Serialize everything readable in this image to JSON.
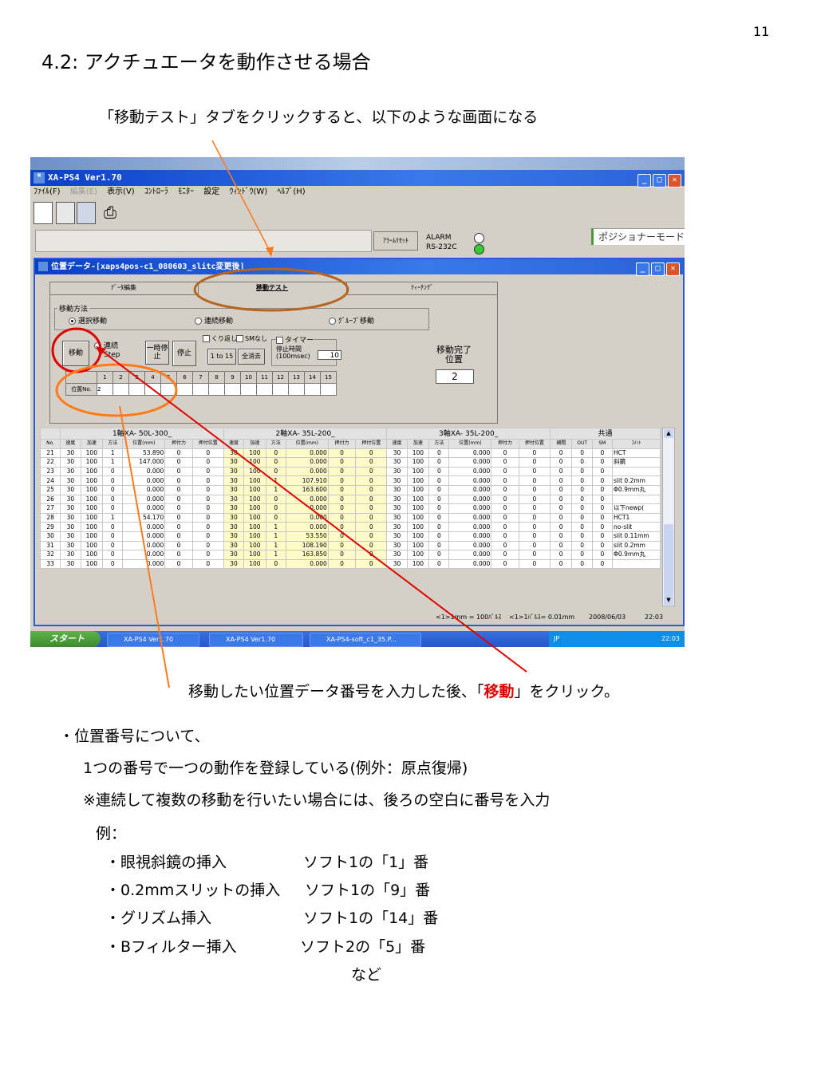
{
  "page_number": "11",
  "title": "4.2: アクチュエータを動作させる場合",
  "intro": "「移動テスト」タブをクリックすると、以下のような画面になる",
  "app": {
    "title": "XA-PS4 Ver1.70",
    "menu": [
      "ﾌｧｲﾙ(F)",
      "編集(E)",
      "表示(V)",
      "ｺﾝﾄﾛｰﾗ",
      "ﾓﾆﾀｰ",
      "設定",
      "ｳｨﾝﾄﾞｳ(W)",
      "ﾍﾙﾌﾟ(H)"
    ],
    "alarm_reset": "ｱﾗｰﾑﾘｾｯﾄ",
    "alarm_label": "ALARM",
    "rs232c_label": "RS-232C",
    "mode": "ポジショナーモード",
    "status_colors": {
      "alarm": "#ffffff",
      "rs232c": "#33cc33"
    }
  },
  "data_window": {
    "title": "位置データ-[xaps4pos-c1_080603_slitc変更後]",
    "tabs": [
      "ﾃﾞｰﾀ編集",
      "移動テスト",
      "ﾃｨｰﾁﾝｸﾞ"
    ],
    "move_method_label": "移動方法",
    "radios": [
      "選択移動",
      "連続移動",
      "ｸﾞﾙｰﾌﾟ移動"
    ],
    "move_button": "移動",
    "continuous": "連続",
    "step": "Step",
    "pause": "一時停止",
    "stop": "停止",
    "repeat": "くり返し",
    "no_sm": "SMなし",
    "timer": "タイマー",
    "one_to_15": "1 to 15",
    "clear_all": "全消去",
    "stop_time_label": "停止時間(100msec)",
    "stop_time_value": "10",
    "move_done_label": "移動完了位置",
    "move_done_value": "2",
    "pos_no_label": "位置No.",
    "pos_cols": [
      "1",
      "2",
      "3",
      "4",
      "5",
      "6",
      "7",
      "8",
      "9",
      "10",
      "11",
      "12",
      "13",
      "14",
      "15"
    ],
    "pos_values": [
      "2",
      "",
      "",
      "",
      "",
      "",
      "",
      "",
      "",
      "",
      "",
      "",
      "",
      "",
      ""
    ]
  },
  "grid": {
    "axis_headers": [
      "1軸XA- 50L-300_",
      "2軸XA- 35L-200_",
      "3軸XA- 35L-200_",
      "共通"
    ],
    "col_headers": [
      "No.",
      "速度",
      "加速",
      "方法",
      "位置(mm)",
      "押付力",
      "押付位置",
      "速度",
      "加速",
      "方法",
      "位置(mm)",
      "押付力",
      "押付位置",
      "速度",
      "加速",
      "方法",
      "位置(mm)",
      "押付力",
      "押付位置",
      "補間",
      "OUT",
      "SM",
      "ｺﾒﾝﾄ"
    ],
    "rows": [
      [
        "21",
        "30",
        "100",
        "1",
        "53.890",
        "0",
        "0",
        "30",
        "100",
        "0",
        "0.000",
        "0",
        "0",
        "30",
        "100",
        "0",
        "0.000",
        "0",
        "0",
        "0",
        "0",
        "0",
        "HCT"
      ],
      [
        "22",
        "30",
        "100",
        "1",
        "147.000",
        "0",
        "0",
        "30",
        "100",
        "0",
        "0.000",
        "0",
        "0",
        "30",
        "100",
        "0",
        "0.000",
        "0",
        "0",
        "0",
        "0",
        "0",
        "斜鏡"
      ],
      [
        "23",
        "30",
        "100",
        "0",
        "0.000",
        "0",
        "0",
        "30",
        "100",
        "0",
        "0.000",
        "0",
        "0",
        "30",
        "100",
        "0",
        "0.000",
        "0",
        "0",
        "0",
        "0",
        "0",
        ""
      ],
      [
        "24",
        "30",
        "100",
        "0",
        "0.000",
        "0",
        "0",
        "30",
        "100",
        "1",
        "107.910",
        "0",
        "0",
        "30",
        "100",
        "0",
        "0.000",
        "0",
        "0",
        "0",
        "0",
        "0",
        "slit 0.2mm"
      ],
      [
        "25",
        "30",
        "100",
        "0",
        "0.000",
        "0",
        "0",
        "30",
        "100",
        "1",
        "163.600",
        "0",
        "0",
        "30",
        "100",
        "0",
        "0.000",
        "0",
        "0",
        "0",
        "0",
        "0",
        "Φ0.9mm丸"
      ],
      [
        "26",
        "30",
        "100",
        "0",
        "0.000",
        "0",
        "0",
        "30",
        "100",
        "0",
        "0.000",
        "0",
        "0",
        "30",
        "100",
        "0",
        "0.000",
        "0",
        "0",
        "0",
        "0",
        "0",
        ""
      ],
      [
        "27",
        "30",
        "100",
        "0",
        "0.000",
        "0",
        "0",
        "30",
        "100",
        "0",
        "0.000",
        "0",
        "0",
        "30",
        "100",
        "0",
        "0.000",
        "0",
        "0",
        "0",
        "0",
        "0",
        "以下newp("
      ],
      [
        "28",
        "30",
        "100",
        "1",
        "54.170",
        "0",
        "0",
        "30",
        "100",
        "0",
        "0.000",
        "0",
        "0",
        "30",
        "100",
        "0",
        "0.000",
        "0",
        "0",
        "0",
        "0",
        "0",
        "HCT1"
      ],
      [
        "29",
        "30",
        "100",
        "0",
        "0.000",
        "0",
        "0",
        "30",
        "100",
        "1",
        "0.000",
        "0",
        "0",
        "30",
        "100",
        "0",
        "0.000",
        "0",
        "0",
        "0",
        "0",
        "0",
        "no-slit"
      ],
      [
        "30",
        "30",
        "100",
        "0",
        "0.000",
        "0",
        "0",
        "30",
        "100",
        "1",
        "53.550",
        "0",
        "0",
        "30",
        "100",
        "0",
        "0.000",
        "0",
        "0",
        "0",
        "0",
        "0",
        "slit 0.11mm"
      ],
      [
        "31",
        "30",
        "100",
        "0",
        "0.000",
        "0",
        "0",
        "30",
        "100",
        "1",
        "108.190",
        "0",
        "0",
        "30",
        "100",
        "0",
        "0.000",
        "0",
        "0",
        "0",
        "0",
        "0",
        "slit 0.2mm"
      ],
      [
        "32",
        "30",
        "100",
        "0",
        "0.000",
        "0",
        "0",
        "30",
        "100",
        "1",
        "163.850",
        "0",
        "0",
        "30",
        "100",
        "0",
        "0.000",
        "0",
        "0",
        "0",
        "0",
        "0",
        "Φ0.9mm丸"
      ],
      [
        "33",
        "30",
        "100",
        "0",
        "0.000",
        "0",
        "0",
        "30",
        "100",
        "0",
        "0.000",
        "0",
        "0",
        "30",
        "100",
        "0",
        "0.000",
        "0",
        "0",
        "0",
        "0",
        "0",
        ""
      ]
    ]
  },
  "status": {
    "pulse1": "<1>1mm = 100ﾊﾟﾙｽ",
    "pulse2": "<1>1ﾊﾟﾙｽ= 0.01mm",
    "date": "2008/06/03",
    "time": "22:03"
  },
  "taskbar": {
    "start": "スタート",
    "tasks": [
      "XA-PS4 Ver1.70",
      "XA-PS4 Ver1.70",
      "XA-PS4-soft_c1_35.P..."
    ],
    "ime": "JP",
    "clock": "22:03"
  },
  "caption_pre": "移動したい位置データ番号を入力した後、「",
  "caption_red": "移動",
  "caption_post": "」をクリック。",
  "notes": {
    "heading": "・位置番号について、",
    "line1": "1つの番号で一つの動作を登録している(例外：原点復帰)",
    "line2": "※連続して複数の移動を行いたい場合には、後ろの空白に番号を入力",
    "example_label": "例：",
    "examples": [
      {
        "item": "・眼視斜鏡の挿入",
        "value": "ソフト1の「1」番"
      },
      {
        "item": "・0.2mmスリットの挿入",
        "value": "ソフト1の「9」番"
      },
      {
        "item": "・グリズム挿入",
        "value": "ソフト1の「14」番"
      },
      {
        "item": "・Bフィルター挿入",
        "value": "ソフト2の「5」番"
      }
    ],
    "etc": "など"
  }
}
